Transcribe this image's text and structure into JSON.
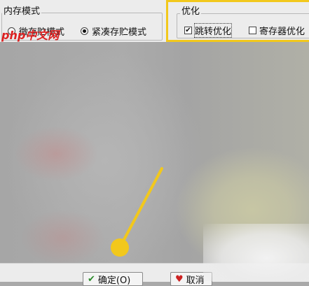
{
  "memory_group": {
    "title": "内存模式",
    "options": [
      {
        "label": "微存贮模式",
        "selected": false
      },
      {
        "label": "紧凑存贮模式",
        "selected": true
      }
    ]
  },
  "optimize_group": {
    "title": "优化",
    "options": [
      {
        "label": "跳转优化",
        "checked": true
      },
      {
        "label": "寄存器优化",
        "checked": false
      }
    ]
  },
  "watermark": "php中文网",
  "buttons": {
    "ok_label": "确定(O)",
    "cancel_label": "取消"
  },
  "colors": {
    "highlight": "#f2c81c",
    "pointer": "#f2c81c"
  }
}
